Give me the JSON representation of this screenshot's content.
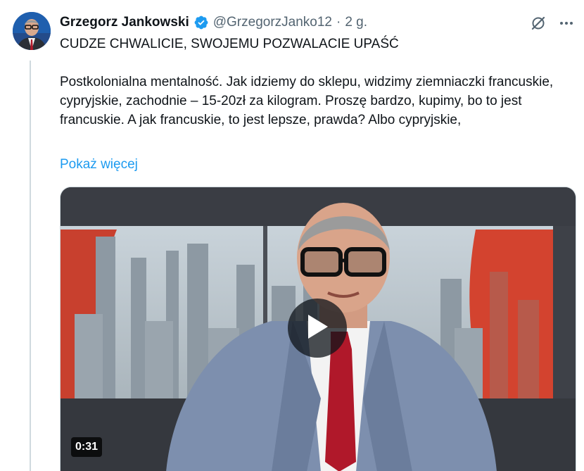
{
  "tweet": {
    "author": {
      "display_name": "Grzegorz Jankowski",
      "handle": "@GrzegorzJanko12",
      "verified": true
    },
    "separator": "·",
    "time": "2 g.",
    "headline": "CUDZE CHWALICIE, SWOJEMU POZWALACIE UPAŚĆ",
    "body": "Postkolonialna mentalność. Jak idziemy do sklepu, widzimy ziemniaczki francuskie, cypryjskie, zachodnie – 15-20zł za kilogram. Proszę bardzo, kupimy, bo to jest francuskie. A jak francuskie, to jest lepsze, prawda? Albo cypryjskie,",
    "show_more": "Pokaż więcej",
    "media": {
      "type": "video",
      "duration": "0:31",
      "play_icon": "play-icon"
    }
  },
  "icons": {
    "verified": "verified-badge-icon",
    "grok": "grok-icon",
    "more": "more-icon"
  },
  "colors": {
    "link": "#1d9bf0",
    "verified": "#1d9bf0",
    "secondary_text": "#536471",
    "thread_line": "#cfd9de"
  }
}
